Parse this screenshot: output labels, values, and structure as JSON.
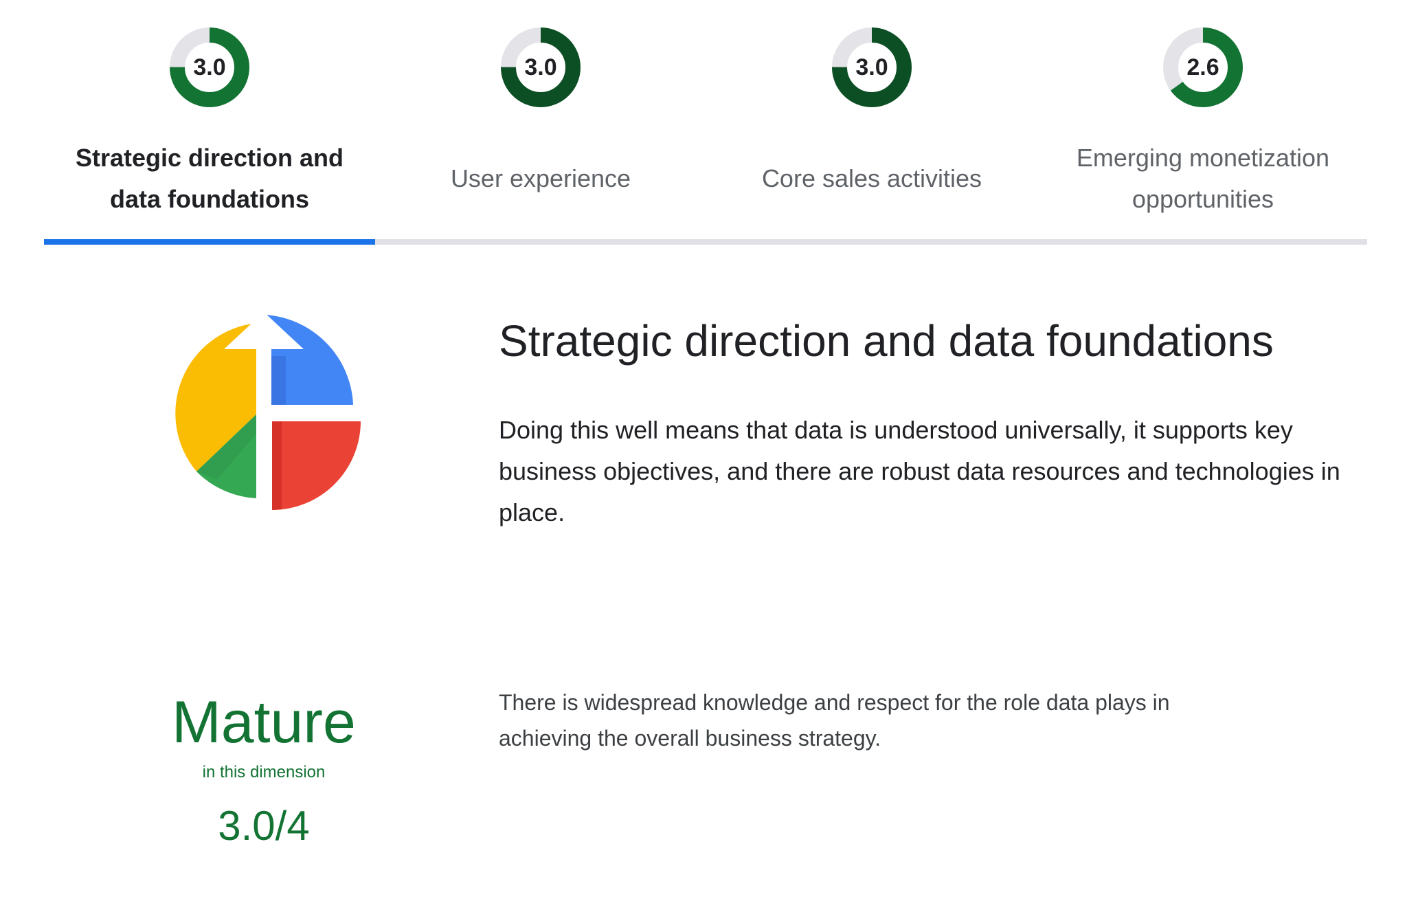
{
  "tabs": [
    {
      "label": "Strategic direction and data foundations",
      "score": "3.0",
      "fraction": 0.75,
      "ring_color": "#137333",
      "active": true
    },
    {
      "label": "User experience",
      "score": "3.0",
      "fraction": 0.75,
      "ring_color": "#0d4f24",
      "active": false
    },
    {
      "label": "Core sales activities",
      "score": "3.0",
      "fraction": 0.75,
      "ring_color": "#0d4f24",
      "active": false
    },
    {
      "label": "Emerging monetization opportunities",
      "score": "2.6",
      "fraction": 0.65,
      "ring_color": "#137333",
      "active": false
    }
  ],
  "colors": {
    "accent": "#1a73e8",
    "track": "#e0e0e6",
    "mature_green": "#137333",
    "icon_blue": "#4285f4",
    "icon_red": "#ea4335",
    "icon_yellow": "#fbbc04",
    "icon_green": "#34a853"
  },
  "detail": {
    "icon": "strategy-pie-chart-arrow-icon",
    "title": "Strategic direction and data foundations",
    "description": "Doing this well means that data is understood universally, it supports key business objectives, and there are robust data resources and technologies in place."
  },
  "maturity": {
    "level": "Mature",
    "subtitle": "in this dimension",
    "score": "3.0/4",
    "description": "There is widespread knowledge and respect for the role data plays in achieving the overall business strategy."
  }
}
